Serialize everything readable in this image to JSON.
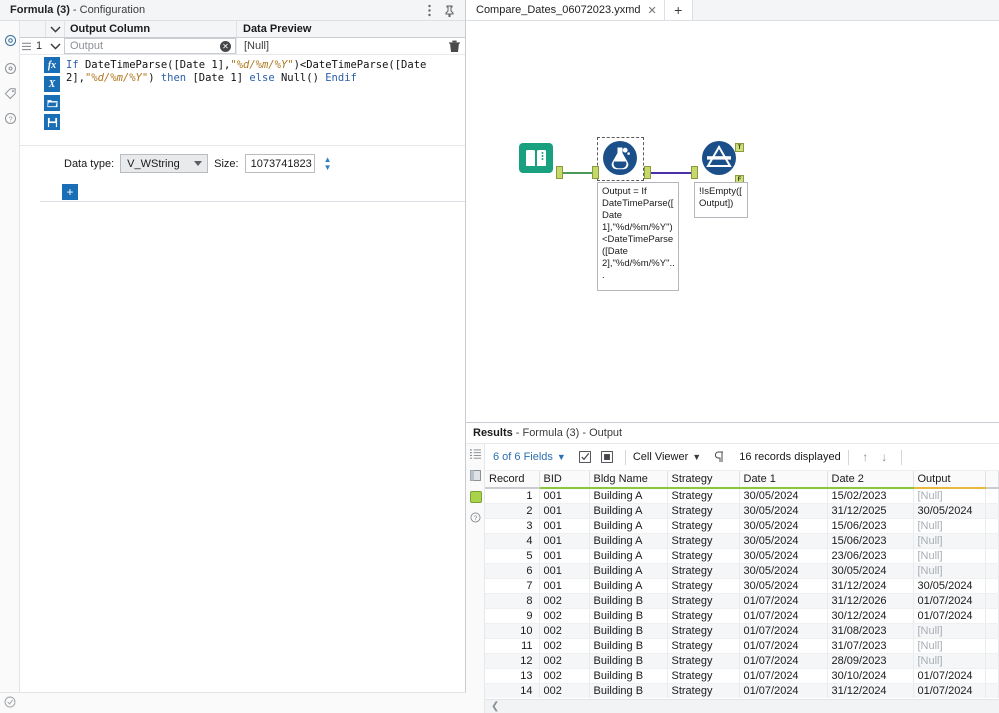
{
  "config_panel": {
    "title_bold": "Formula (3)",
    "title_rest": "- Configuration",
    "kebab_icon": "kebab-menu-icon",
    "pin_icon": "pin-icon",
    "rail_icons": [
      "gear-icon",
      "target-icon",
      "tag-icon",
      "help-circle-icon"
    ],
    "grid": {
      "header_output_column": "Output Column",
      "header_data_preview": "Data Preview",
      "row_number": "1",
      "output_value": "Output",
      "output_placeholder": "Output",
      "data_preview_value": "[Null]",
      "clear_icon": "clear-circle-icon",
      "delete_icon": "trash-icon",
      "chevron_icon": "chevron-down-icon",
      "drag_handle_icon": "drag-handle-icon"
    },
    "formula_tools": [
      {
        "name": "functions-icon",
        "glyph": "fx"
      },
      {
        "name": "variables-icon",
        "glyph": "X"
      },
      {
        "name": "open-folder-icon",
        "glyph": "❐"
      },
      {
        "name": "save-icon",
        "glyph": "Ὃe"
      }
    ],
    "formula": {
      "full_text": "If DateTimeParse([Date 1],\"%d/%m/%Y\")<DateTimeParse([Date 2],\"%d/%m/%Y\") then [Date 1] else Null() Endif",
      "tokens": [
        {
          "t": "If ",
          "c": "kw"
        },
        {
          "t": "DateTimeParse([Date 1],",
          "c": "fn"
        },
        {
          "t": "\"%d/%m/%Y\"",
          "c": "str"
        },
        {
          "t": ")<DateTimeParse([Date 2],",
          "c": "fn"
        },
        {
          "t": "\"%d/%m/%Y\"",
          "c": "str"
        },
        {
          "t": ") ",
          "c": "fn"
        },
        {
          "t": "then ",
          "c": "kw"
        },
        {
          "t": "[Date 1] ",
          "c": "fn"
        },
        {
          "t": "else ",
          "c": "kw"
        },
        {
          "t": "Null() ",
          "c": "fn"
        },
        {
          "t": "Endif",
          "c": "kw"
        }
      ]
    },
    "data_type_label": "Data type:",
    "data_type_value": "V_WString",
    "size_label": "Size:",
    "size_value": "1073741823",
    "add_button": "+",
    "status_icon": "status-ok-icon"
  },
  "tabbar": {
    "tab_name": "Compare_Dates_06072023.yxmd",
    "close_icon": "close-icon",
    "new_tab_icon": "plus-icon"
  },
  "canvas": {
    "nodes": [
      {
        "id": "input-data-node",
        "icon": "book-input-icon",
        "label": ""
      },
      {
        "id": "formula-node",
        "icon": "flask-formula-icon",
        "selected": true,
        "annotation": "Output = If DateTimeParse([Date 1],\"%d/%m/%Y\")<DateTimeParse([Date 2],\"%d/%m/%Y\"..."
      },
      {
        "id": "filter-node",
        "icon": "filter-funnel-icon",
        "annotation": "!IsEmpty([Output])",
        "out_true": "T",
        "out_false": "F"
      }
    ],
    "colors": {
      "input_node": "#18a07f",
      "tool_node": "#1a4f8a",
      "wire_green": "#4a9a5a",
      "wire_purple": "#4b2fa8"
    }
  },
  "results": {
    "title_bold": "Results",
    "title_rest": "- Formula (3) - Output",
    "rail_icons": [
      "list-view-icon",
      "layout-icon",
      "green-output-icon",
      "help-circle-icon"
    ],
    "toolbar": {
      "fields_label": "6 of 6 Fields",
      "fields_chevron": "chevron-down-icon",
      "select_icon": "checkbox-select-icon",
      "deselect_icon": "deselect-icon",
      "viewer_label": "Cell Viewer",
      "viewer_chevron": "chevron-down-icon",
      "pilcrow_icon": "pilcrow-icon",
      "records_label": "16 records displayed",
      "up_icon": "arrow-up-icon",
      "down_icon": "arrow-down-icon"
    },
    "columns": [
      "Record",
      "BID",
      "Bldg Name",
      "Strategy",
      "Date 1",
      "Date 2",
      "Output"
    ],
    "rows": [
      [
        "1",
        "001",
        "Building A",
        "Strategy",
        "30/05/2024",
        "15/02/2023",
        "[Null]"
      ],
      [
        "2",
        "001",
        "Building A",
        "Strategy",
        "30/05/2024",
        "31/12/2025",
        "30/05/2024"
      ],
      [
        "3",
        "001",
        "Building A",
        "Strategy",
        "30/05/2024",
        "15/06/2023",
        "[Null]"
      ],
      [
        "4",
        "001",
        "Building A",
        "Strategy",
        "30/05/2024",
        "15/06/2023",
        "[Null]"
      ],
      [
        "5",
        "001",
        "Building A",
        "Strategy",
        "30/05/2024",
        "23/06/2023",
        "[Null]"
      ],
      [
        "6",
        "001",
        "Building A",
        "Strategy",
        "30/05/2024",
        "30/05/2024",
        "[Null]"
      ],
      [
        "7",
        "001",
        "Building A",
        "Strategy",
        "30/05/2024",
        "31/12/2024",
        "30/05/2024"
      ],
      [
        "8",
        "002",
        "Building B",
        "Strategy",
        "01/07/2024",
        "31/12/2026",
        "01/07/2024"
      ],
      [
        "9",
        "002",
        "Building B",
        "Strategy",
        "01/07/2024",
        "30/12/2024",
        "01/07/2024"
      ],
      [
        "10",
        "002",
        "Building B",
        "Strategy",
        "01/07/2024",
        "31/08/2023",
        "[Null]"
      ],
      [
        "11",
        "002",
        "Building B",
        "Strategy",
        "01/07/2024",
        "31/07/2023",
        "[Null]"
      ],
      [
        "12",
        "002",
        "Building B",
        "Strategy",
        "01/07/2024",
        "28/09/2023",
        "[Null]"
      ],
      [
        "13",
        "002",
        "Building B",
        "Strategy",
        "01/07/2024",
        "30/10/2024",
        "01/07/2024"
      ],
      [
        "14",
        "002",
        "Building B",
        "Strategy",
        "01/07/2024",
        "31/12/2024",
        "01/07/2024"
      ]
    ],
    "scroll_left_icon": "chevron-left-icon"
  }
}
